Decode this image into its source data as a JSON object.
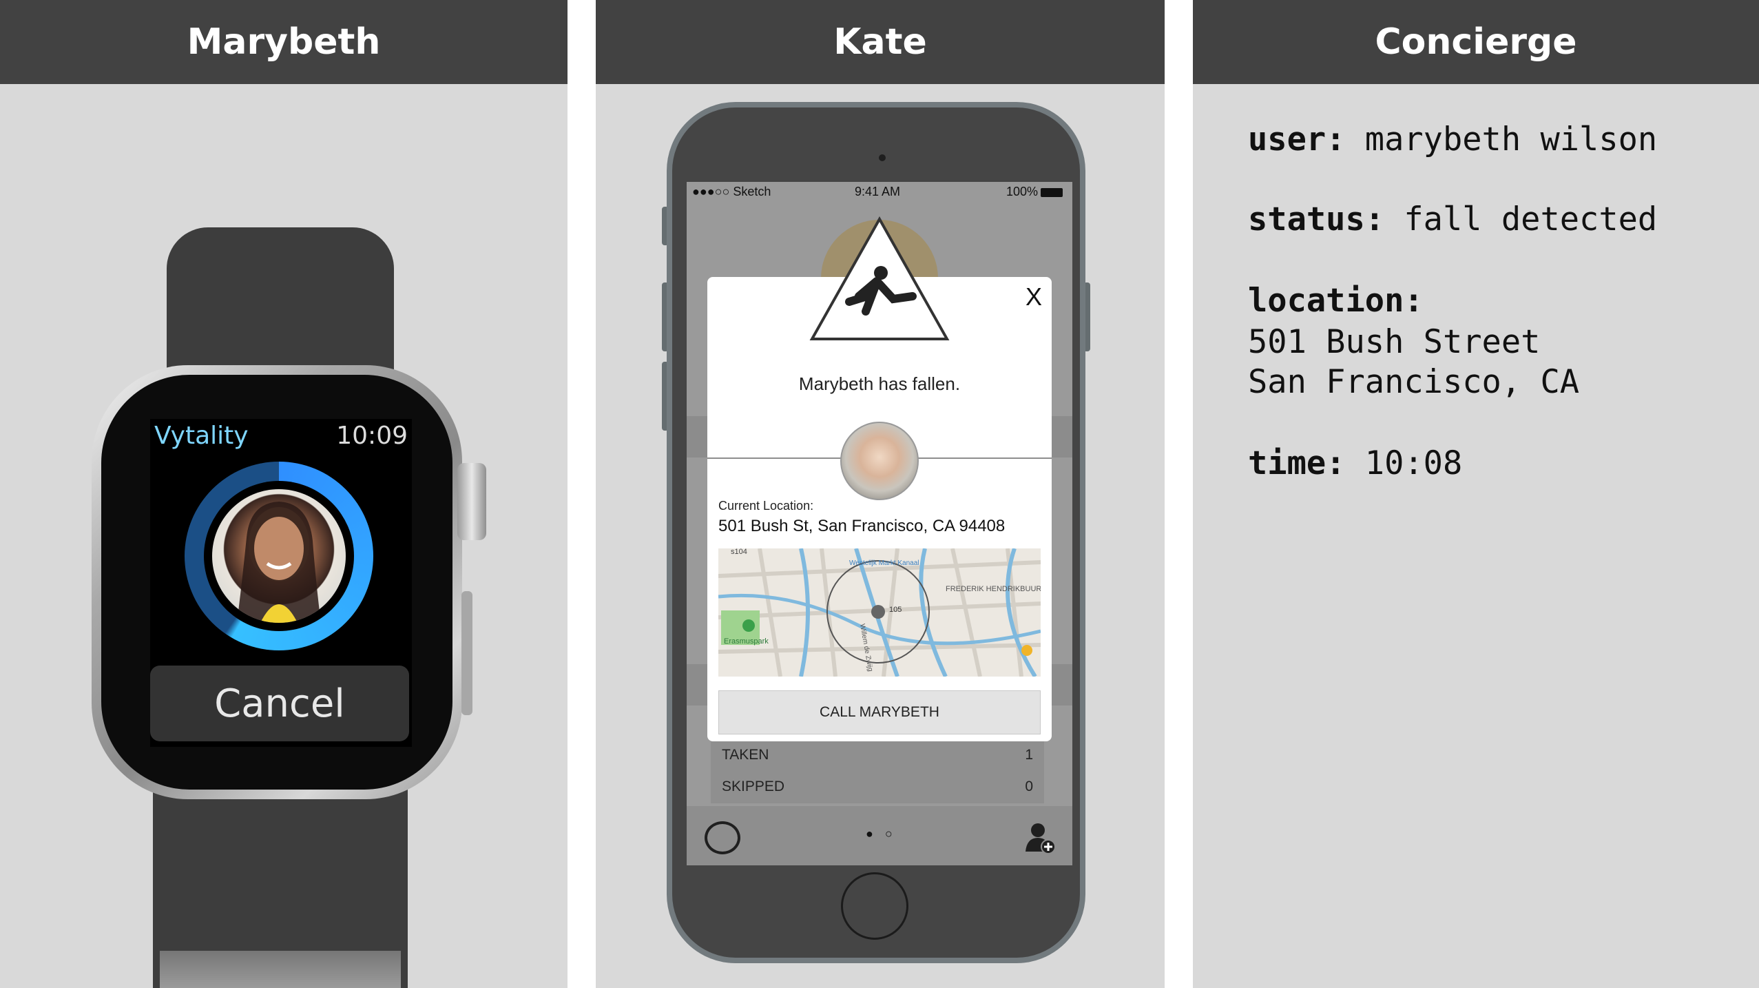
{
  "panels": {
    "left": {
      "title": "Marybeth"
    },
    "middle": {
      "title": "Kate"
    },
    "right": {
      "title": "Concierge"
    }
  },
  "watch": {
    "app_name": "Vytality",
    "time": "10:09",
    "cancel_label": "Cancel",
    "ring_color": "#36c0ff"
  },
  "phone": {
    "status_left": "●●●○○ Sketch",
    "status_time": "9:41 AM",
    "status_battery": "100%",
    "rows": [
      {
        "label": "TAKEN",
        "value": "1"
      },
      {
        "label": "SKIPPED",
        "value": "0"
      }
    ],
    "page_dots": "● ○",
    "dialog": {
      "close_label": "X",
      "message": "Marybeth has fallen.",
      "location_label": "Current Location:",
      "location": "501 Bush St, San Francisco, CA 94408",
      "call_label": "CALL MARYBETH",
      "map_labels": [
        "s104",
        "Erasmuspark",
        "FREDERIK HENDRIKBUURT",
        "105",
        "Westelijk Markt Kanaal",
        "Willem de Zwijg"
      ]
    }
  },
  "concierge": {
    "user_key": "user:",
    "user_value": "marybeth wilson",
    "status_key": "status:",
    "status_value": "fall detected",
    "location_key": "location:",
    "location_line1": "501 Bush Street",
    "location_line2": "San Francisco, CA",
    "time_key": "time:",
    "time_value": "10:08"
  }
}
